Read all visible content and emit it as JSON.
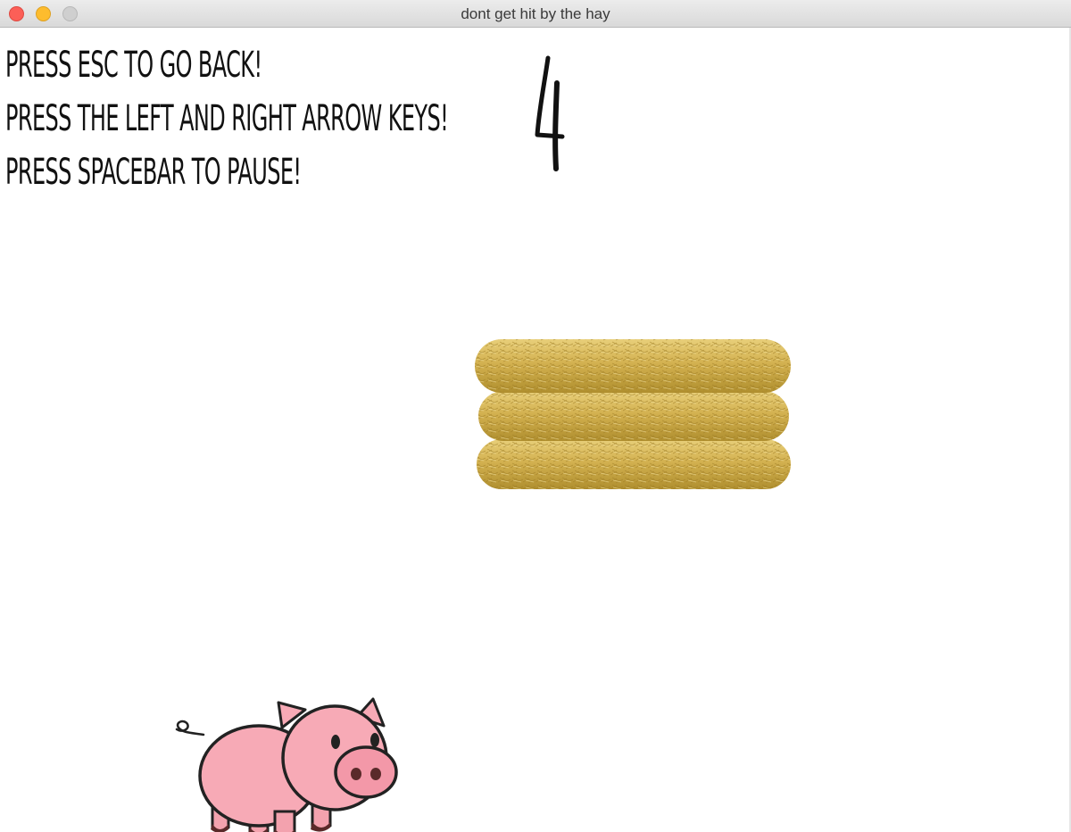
{
  "window": {
    "title": "dont get hit by the hay"
  },
  "instructions": [
    "PRESS ESC TO GO BACK!",
    "PRESS THE LEFT AND RIGHT ARROW KEYS!",
    "PRESS SPACEBAR TO PAUSE!"
  ],
  "game": {
    "counter": "4",
    "player": "pig",
    "obstacle": "hay-bale-stack"
  },
  "colors": {
    "hay": "#d2b04a",
    "pig": "#f7aab6"
  }
}
